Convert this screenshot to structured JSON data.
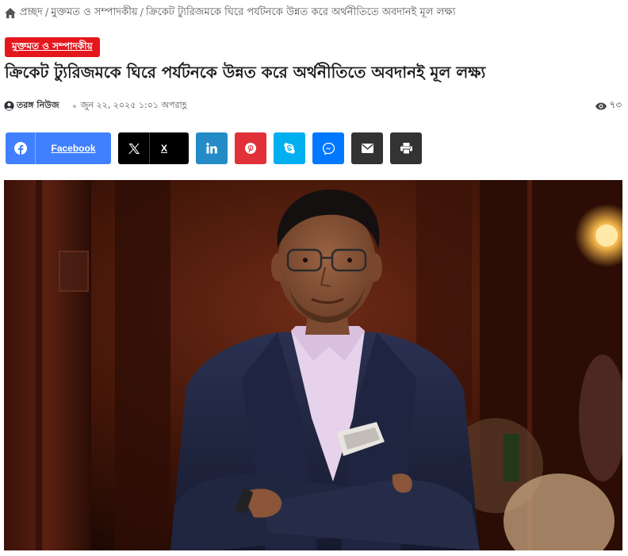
{
  "breadcrumb": {
    "home_icon": "home-icon",
    "items": [
      "প্রচ্ছদ",
      "মুক্তমত ও সম্পাদকীয়",
      "ক্রিকেট ট্যুরিজমকে ঘিরে পর্যটনকে উন্নত করে অর্থনীতিতে অবদানই মূল লক্ষ্য"
    ],
    "separator": "/"
  },
  "article": {
    "category": "মুক্তমত ও সম্পাদকীয়",
    "title": "ক্রিকেট ট্যুরিজমকে ঘিরে পর্যটনকে উন্নত করে অর্থনীতিতে অবদানই মূল লক্ষ্য",
    "author": "তরঙ্গ নিউজ",
    "date": "জুন ২২, ২০২৫ ১:০১ অপরাহ্ণ",
    "views": "৭৩"
  },
  "share": {
    "facebook_label": "Facebook",
    "x_label": "X",
    "buttons": [
      "facebook",
      "x",
      "linkedin",
      "pinterest",
      "skype",
      "messenger",
      "email",
      "print"
    ]
  },
  "colors": {
    "category_badge": "#e4171d",
    "facebook": "#4080ff",
    "x": "#000000",
    "linkedin": "#238cc8",
    "pinterest": "#e13138",
    "skype": "#00aff0",
    "messenger": "#0078ff",
    "email": "#333333",
    "print": "#333333"
  },
  "featured_image": {
    "subject": "photo-of-man-in-suit"
  }
}
